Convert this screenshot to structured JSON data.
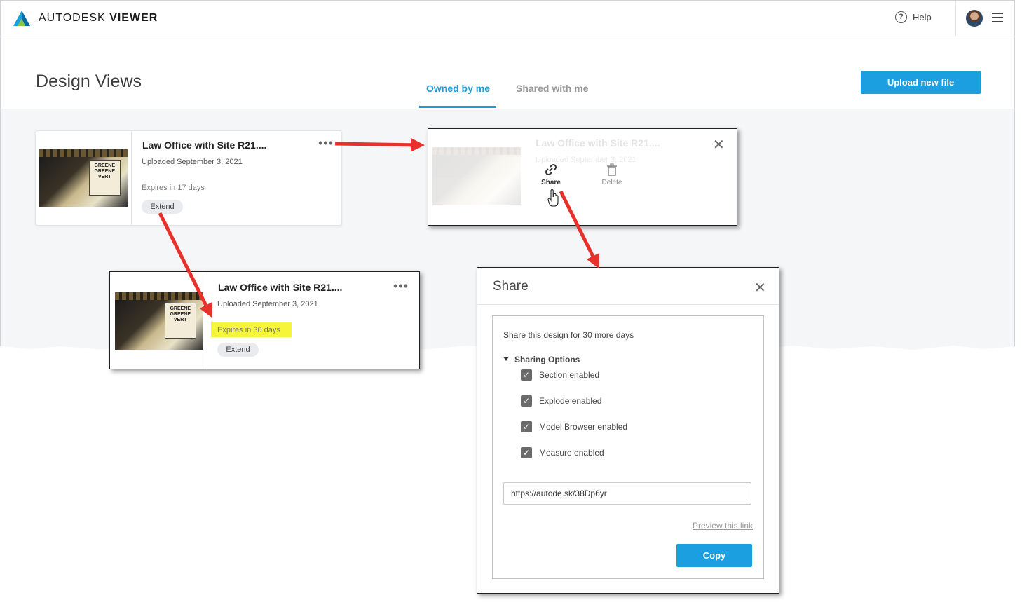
{
  "app": {
    "brand_light": "AUTODESK",
    "brand_bold": "VIEWER",
    "help_label": "Help",
    "page_title": "Design Views",
    "tabs": [
      {
        "label": "Owned by me",
        "active": true
      },
      {
        "label": "Shared with me",
        "active": false
      }
    ],
    "upload_label": "Upload new file"
  },
  "card": {
    "title": "Law Office with Site R21....",
    "uploaded": "Uploaded September 3, 2021",
    "expires": "Expires in 17 days",
    "extend_label": "Extend",
    "thumb_text": "GREENE GREENE VERT"
  },
  "popup": {
    "ghost_title": "Law Office with Site R21....",
    "ghost_sub": "Uploaded September 3, 2021",
    "share_label": "Share",
    "delete_label": "Delete"
  },
  "zoom_card": {
    "title": "Law Office with Site R21....",
    "uploaded": "Uploaded September 3, 2021",
    "expires": "Expires in 30 days",
    "extend_label": "Extend"
  },
  "share_dialog": {
    "title": "Share",
    "lead": "Share this design for 30 more days",
    "options_header": "Sharing Options",
    "options": [
      {
        "label": "Section enabled",
        "checked": true
      },
      {
        "label": "Explode enabled",
        "checked": true
      },
      {
        "label": "Model Browser enabled",
        "checked": true
      },
      {
        "label": "Measure enabled",
        "checked": true
      }
    ],
    "link": "https://autode.sk/38Dp6yr",
    "preview_label": "Preview this link",
    "copy_label": "Copy"
  },
  "colors": {
    "accent": "#1c9fe0",
    "tab_active": "#1e9ad6",
    "arrow": "#e8312a",
    "highlight": "#f6f53a"
  }
}
